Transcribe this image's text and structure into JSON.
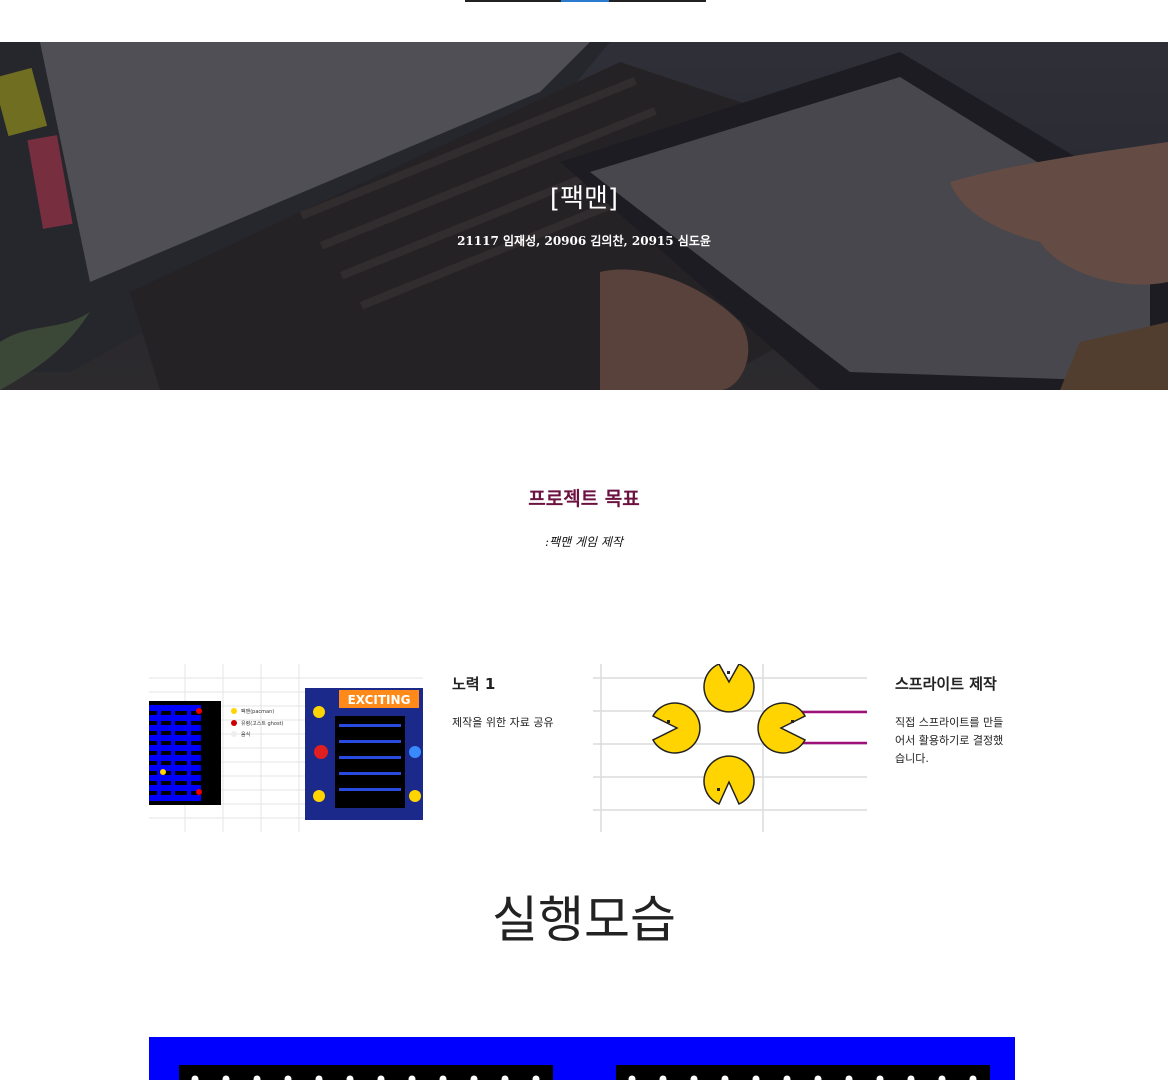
{
  "hero": {
    "title": "[팩맨]",
    "subtitle": "21117 임재성, 20906 김의찬, 20915 심도윤"
  },
  "goal": {
    "title": "프로젝트 목표",
    "subtitle": ":팩맨 게임 제작"
  },
  "cards": [
    {
      "title": "노력 1",
      "body": "제작을 위한 자료 공유"
    },
    {
      "title": "스프라이트 제작",
      "body": "직접 스프라이트를 만들어서 활용하기로 결정했습니다."
    }
  ],
  "card1_image": {
    "legend": [
      "팩맨(pacman)",
      "유령(고스트 ghost)",
      "음식"
    ],
    "marquee": "EXCITING"
  },
  "run": {
    "title": "실행모습"
  },
  "colors": {
    "accent": "#6b1240",
    "maze_blue": "#0000ff",
    "pacman_yellow": "#ffd400"
  }
}
